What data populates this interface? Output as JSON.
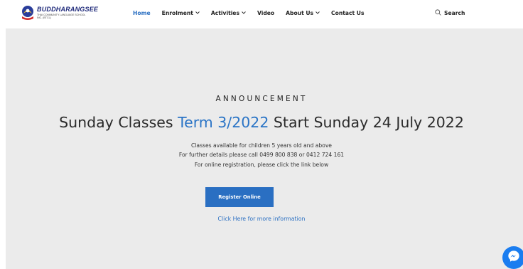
{
  "logo": {
    "name": "BUDDHARANGSEE",
    "subtitle": "THAI COMMUNITY LANGUAGE SCHOOL INC. (BTCL)"
  },
  "nav": {
    "items": [
      {
        "label": "Home",
        "active": true,
        "dropdown": false
      },
      {
        "label": "Enrolment",
        "active": false,
        "dropdown": true
      },
      {
        "label": "Activities",
        "active": false,
        "dropdown": true
      },
      {
        "label": "Video",
        "active": false,
        "dropdown": false
      },
      {
        "label": "About Us",
        "active": false,
        "dropdown": true
      },
      {
        "label": "Contact Us",
        "active": false,
        "dropdown": false
      }
    ]
  },
  "search": {
    "label": "Search",
    "icon": "search-icon"
  },
  "hero": {
    "eyebrow": "ANNOUNCEMENT",
    "headline_part1": "Sunday Classes ",
    "headline_highlight": "Term 3/2022",
    "headline_part2": " Start Sunday 24 July 2022",
    "info_lines": [
      "Classes available for children 5 years old and above",
      "For further details please call 0499 800 838 or 0412 724 161",
      "For online registration, please click the link below"
    ],
    "register_label": "Register Online",
    "more_link": "Click Here for more information"
  },
  "colors": {
    "accent": "#2a6fc2",
    "hero_bg": "#ebebeb",
    "messenger": "#1a7df0"
  }
}
